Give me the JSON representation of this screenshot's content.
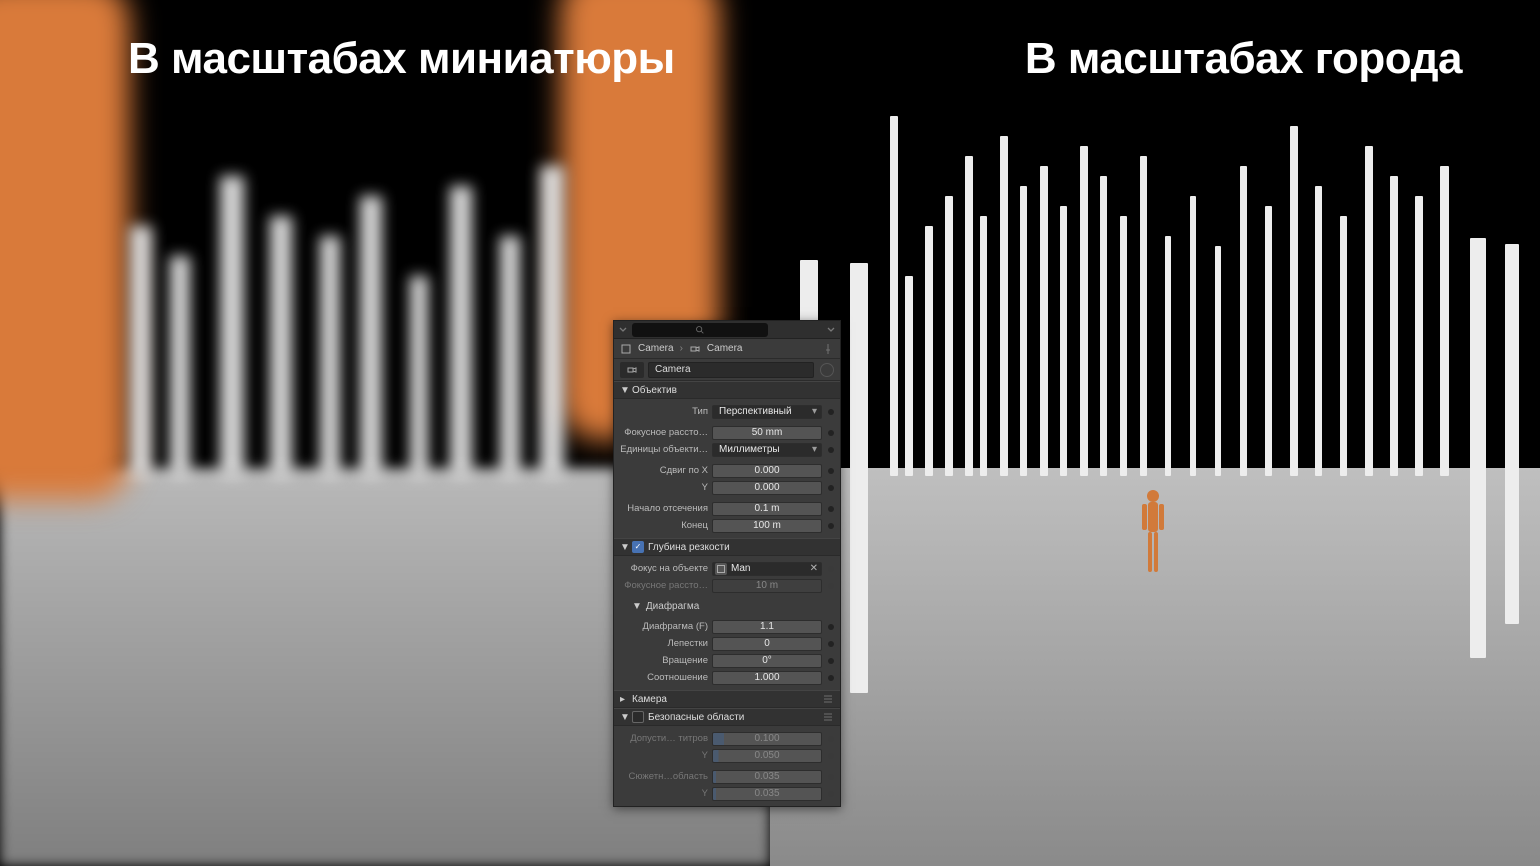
{
  "captions": {
    "left": "В масштабах миниатюры",
    "right": "В масштабах города"
  },
  "panel": {
    "search_placeholder": "",
    "breadcrumb": {
      "object": "Camera",
      "data": "Camera"
    },
    "datablock": {
      "name": "Camera"
    },
    "lens": {
      "title": "Объектив",
      "type_label": "Тип",
      "type_value": "Перспективный",
      "focal_label": "Фокусное рассто…",
      "focal_value": "50 mm",
      "unit_label": "Единицы объекти…",
      "unit_value": "Миллиметры",
      "shift_x_label": "Сдвиг по X",
      "shift_x_value": "0.000",
      "shift_y_label": "Y",
      "shift_y_value": "0.000",
      "clip_start_label": "Начало отсечения",
      "clip_start_value": "0.1 m",
      "clip_end_label": "Конец",
      "clip_end_value": "100 m"
    },
    "dof": {
      "title": "Глубина резкости",
      "enabled": true,
      "focus_obj_label": "Фокус на объекте",
      "focus_obj_value": "Man",
      "focus_dist_label": "Фокусное рассто…",
      "focus_dist_value": "10 m",
      "aperture": {
        "title": "Диафрагма",
        "fstop_label": "Диафрагма (F)",
        "fstop_value": "1.1",
        "blades_label": "Лепестки",
        "blades_value": "0",
        "rotation_label": "Вращение",
        "rotation_value": "0°",
        "ratio_label": "Соотношение",
        "ratio_value": "1.000"
      }
    },
    "camera": {
      "title": "Камера"
    },
    "safe": {
      "title": "Безопасные области",
      "enabled": false,
      "title_safe_label": "Допусти… титров",
      "title_safe_x": "0.100",
      "title_safe_y_label": "Y",
      "title_safe_y": "0.050",
      "action_safe_label": "Сюжетн…область",
      "action_safe_x": "0.035",
      "action_safe_y_label": "Y",
      "action_safe_y": "0.035"
    }
  }
}
